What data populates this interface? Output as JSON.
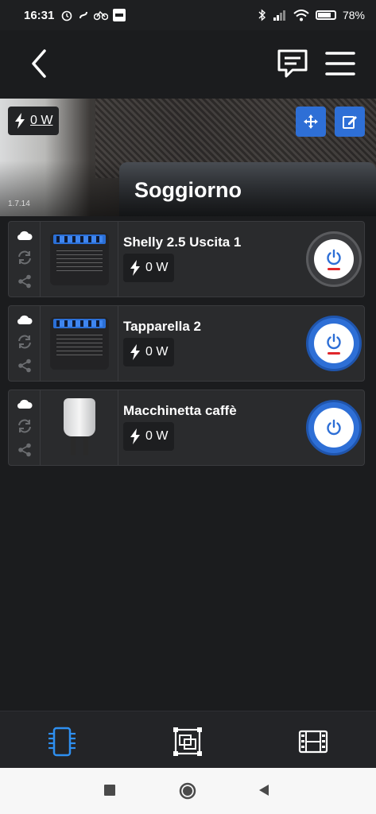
{
  "status_bar": {
    "time": "16:31",
    "left_icons": [
      "alarm-icon",
      "notification-icon",
      "bike-icon",
      "ifttt-icon"
    ],
    "right_icons": [
      "bluetooth-icon",
      "signal-icon",
      "wifi-icon"
    ],
    "battery": "78%"
  },
  "app_bar": {
    "icons": [
      "back-arrow-icon",
      "message-icon",
      "menu-icon"
    ]
  },
  "room": {
    "title": "Soggiorno",
    "power": "0 W",
    "version": "1.7.14"
  },
  "devices": [
    {
      "name": "Shelly 2.5 Uscita 1",
      "power": "0 W",
      "state": "off",
      "image": "shelly-2.5-module"
    },
    {
      "name": "Tapparella 2",
      "power": "0 W",
      "state": "on",
      "image": "shelly-2.5-module"
    },
    {
      "name": "Macchinetta caffè",
      "power": "0 W",
      "state": "on",
      "image": "smart-plug"
    }
  ],
  "bottom_nav": {
    "tabs": [
      "devices-tab",
      "rooms-tab",
      "scenes-tab"
    ],
    "active": "devices-tab"
  },
  "colors": {
    "accent": "#2e6fd6",
    "background": "#1b1c1e",
    "card": "#2a2b2d",
    "off_indicator": "#e0262b"
  }
}
